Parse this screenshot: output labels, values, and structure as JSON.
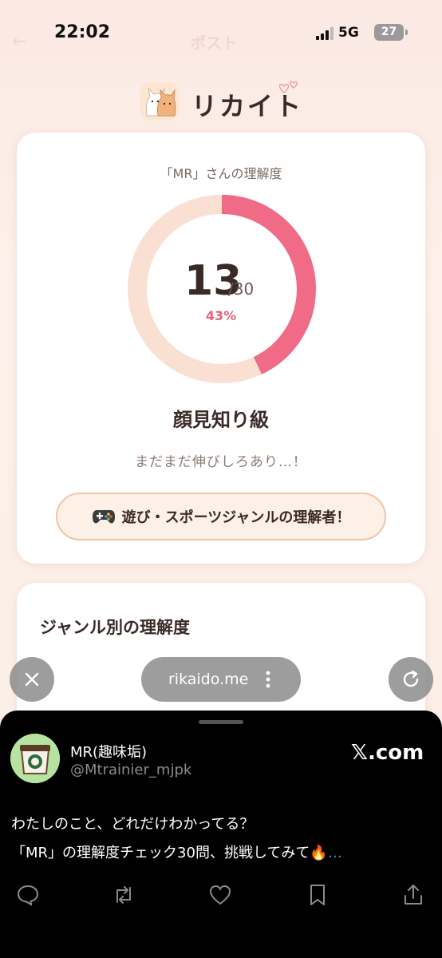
{
  "status_bar": {
    "time": "22:02",
    "network": "5G",
    "battery": "27"
  },
  "ghost_header": {
    "back": "←",
    "title": "ポスト"
  },
  "brand": {
    "name": "リカイト"
  },
  "score": {
    "label": "「MR」さんの理解度",
    "value": "13",
    "total": "/30",
    "percent": "43%",
    "progress": 0.43,
    "rank": "顔見知り級",
    "comment": "まだまだ伸びしろあり…！",
    "badge": "遊び・スポーツジャンルの理解者！",
    "colors": {
      "progress": "#ef6b86",
      "track": "#f9e0d2"
    }
  },
  "genre": {
    "title": "ジャンル別の理解度"
  },
  "browser": {
    "url": "rikaido.me"
  },
  "post": {
    "user_name": "MR(趣味垢)",
    "user_handle": "@Mtrainier_mjpk",
    "source": "𝕏.com",
    "line1": "わたしのこと、どれだけわかってる？",
    "line2": "「MR」の理解度チェック30問、挑戦してみて🔥",
    "more": "…"
  },
  "icons": [
    "reply-icon",
    "repost-icon",
    "like-icon",
    "bookmark-icon",
    "share-icon"
  ]
}
